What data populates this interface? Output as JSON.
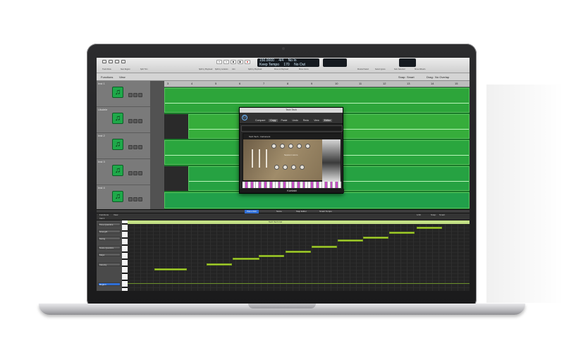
{
  "toolbar": {
    "lcd_bar": "150.0000",
    "lcd_time_sig": "4/4",
    "lcd_key": "No In",
    "lcd_tempo_label": "Keep Tempo",
    "lcd_tempo": "170",
    "lcd_division": "No Out",
    "labels": [
      "Track Draw",
      "New Region",
      "Split Trim",
      "Split by Playhead",
      "Split by Locators",
      "Join",
      "Split by Playhead",
      "Move to Playhead",
      "Move Intens",
      "Musical Select",
      "Select Ignore",
      "Solo Selected",
      "Show Wavefo"
    ]
  },
  "tracks_header": {
    "functions": "Functions",
    "view": "View",
    "snap": "Snap:",
    "snap_value": "Smart",
    "drag": "Drag:",
    "drag_value": "No Overlap"
  },
  "tracks": [
    {
      "name": "Inst 1"
    },
    {
      "name": "Ukulele"
    },
    {
      "name": "Inst 2"
    },
    {
      "name": "Inst 3"
    },
    {
      "name": "Inst 4"
    }
  ],
  "ruler": [
    "3",
    "4",
    "5",
    "6",
    "7",
    "8",
    "9",
    "10",
    "11",
    "12",
    "13",
    "14",
    "15"
  ],
  "plugin": {
    "window_title": "Tech Tech",
    "tabs": [
      "Compare",
      "Copy",
      "Paste",
      "Undo",
      "Redo",
      "View",
      "Editor"
    ],
    "active_tab": "Editor",
    "instrument_name": "Tech Tech - Instrument",
    "logo": "Session Horns",
    "brand": "Kontakt"
  },
  "piano_roll": {
    "tabs": [
      "Piano Roll",
      "Score",
      "Step Editor",
      "Smart Tempo"
    ],
    "active_tab": "Piano Roll",
    "functions": "Functions",
    "view": "View",
    "track_label": "Inst 1",
    "region_label": "Tech Tech Inst",
    "snap": "Snap:",
    "snap_value": "Smart",
    "grid_value": "1/16",
    "inspector_rows": [
      "Time Quantize",
      "Strength",
      "Swing",
      "Scale Quantize",
      "Major",
      "Velocity",
      "Region"
    ]
  },
  "colors": {
    "region_green": "#2da53a",
    "track_icon_green": "#1fa94a",
    "note_green": "#a8d234",
    "active_tab_blue": "#2f6fd6"
  },
  "icons": [
    "music-note-icon",
    "power-icon",
    "play-icon",
    "stop-icon",
    "record-icon",
    "rewind-icon",
    "forward-icon"
  ]
}
